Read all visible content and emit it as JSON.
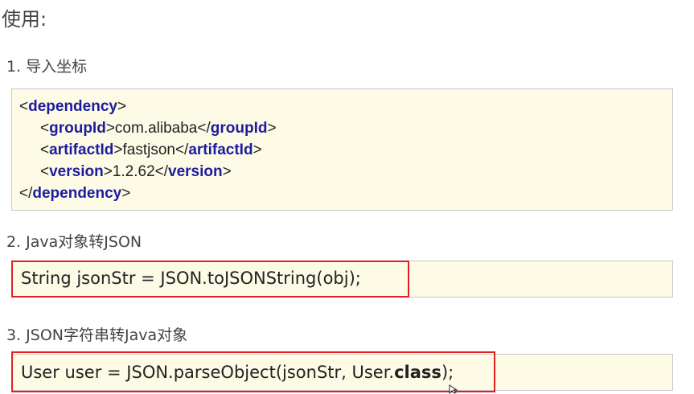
{
  "heading": "使用:",
  "steps": {
    "import": "1. 导入坐标",
    "to_json": "2. Java对象转JSON",
    "from_json": "3. JSON字符串转Java对象"
  },
  "dependency": {
    "lt": "<",
    "gt": ">",
    "lt_close": "</",
    "root_tag": "dependency",
    "group_tag": "groupId",
    "group_value": "com.alibaba",
    "artifact_tag": "artifactId",
    "artifact_value": "fastjson",
    "version_tag": "version",
    "version_value": "1.2.62"
  },
  "code": {
    "to_json": "String jsonStr = JSON.toJSONString(obj);",
    "from_json_prefix": "User user = JSON.parseObject(jsonStr, User.",
    "from_json_keyword": "class",
    "from_json_suffix": ");"
  },
  "colors": {
    "box_background": "#fdfbe6",
    "tag": "#1c1c9e",
    "highlight": "#e02020"
  }
}
